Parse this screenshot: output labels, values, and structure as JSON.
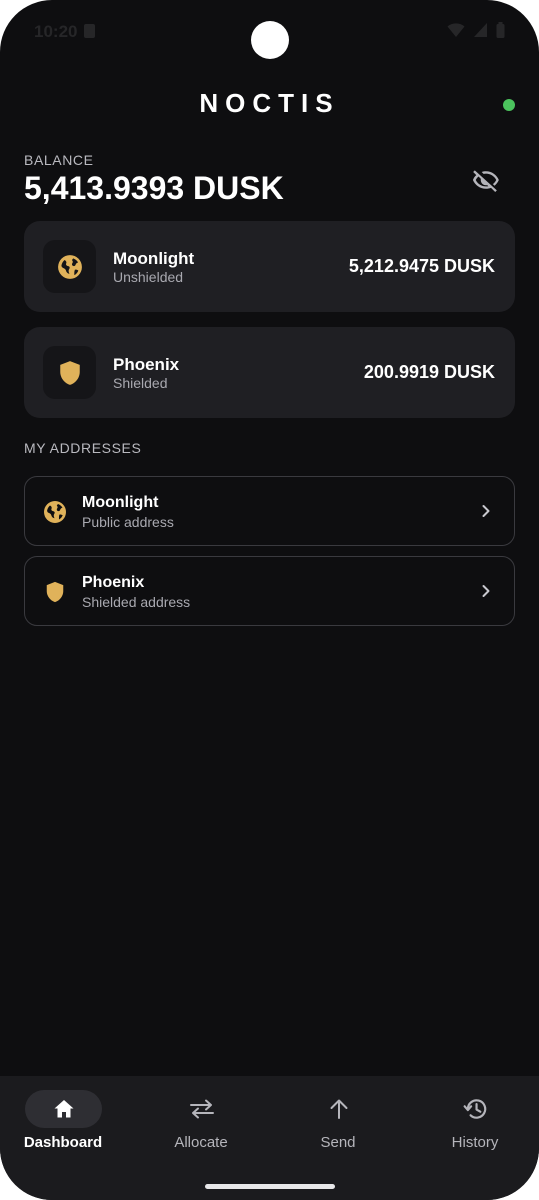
{
  "status_bar": {
    "time": "10:20"
  },
  "app": {
    "title": "NOCTIS",
    "connection_color": "#4bc35d",
    "accent_color": "#e0b25a"
  },
  "balance": {
    "label": "BALANCE",
    "value": "5,413.9393 DUSK",
    "visibility_icon": "eye-off-icon"
  },
  "accounts": [
    {
      "name": "Moonlight",
      "subtitle": "Unshielded",
      "amount": "5,212.9475 DUSK",
      "icon": "globe-icon"
    },
    {
      "name": "Phoenix",
      "subtitle": "Shielded",
      "amount": "200.9919 DUSK",
      "icon": "shield-icon"
    }
  ],
  "addresses": {
    "section_label": "MY ADDRESSES",
    "items": [
      {
        "name": "Moonlight",
        "subtitle": "Public address",
        "icon": "globe-icon"
      },
      {
        "name": "Phoenix",
        "subtitle": "Shielded address",
        "icon": "shield-icon"
      }
    ]
  },
  "nav": {
    "items": [
      {
        "label": "Dashboard",
        "icon": "home-icon",
        "active": true
      },
      {
        "label": "Allocate",
        "icon": "swap-arrows-icon",
        "active": false
      },
      {
        "label": "Send",
        "icon": "arrow-up-icon",
        "active": false
      },
      {
        "label": "History",
        "icon": "history-icon",
        "active": false
      }
    ]
  }
}
